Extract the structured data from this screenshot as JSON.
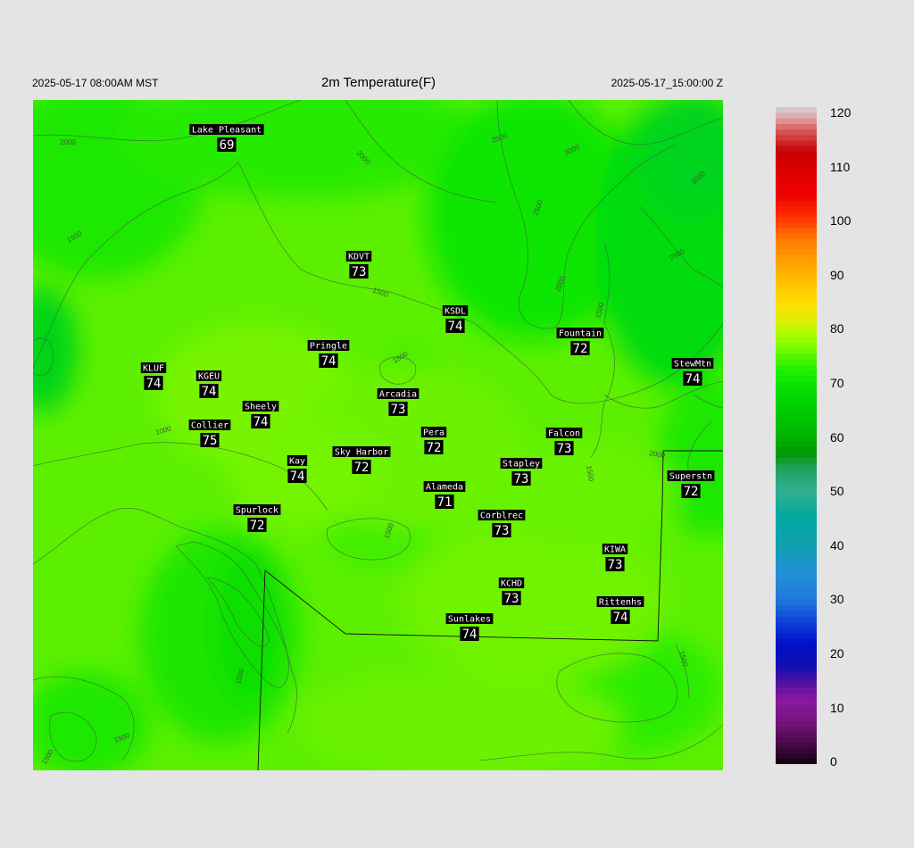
{
  "header": {
    "local_time": "2025-05-17 08:00AM MST",
    "title": "2m Temperature(F)",
    "utc_time": "2025-05-17_15:00:00 Z"
  },
  "colorbar": {
    "ticks": [
      "120",
      "110",
      "100",
      "90",
      "80",
      "70",
      "60",
      "50",
      "40",
      "30",
      "20",
      "10",
      "0"
    ],
    "min": 0,
    "max": 120
  },
  "stations": [
    {
      "name": "Lake Pleasant",
      "value": "69"
    },
    {
      "name": "KDVT",
      "value": "73"
    },
    {
      "name": "KSDL",
      "value": "74"
    },
    {
      "name": "Fountain",
      "value": "72"
    },
    {
      "name": "Pringle",
      "value": "74"
    },
    {
      "name": "StewMtn",
      "value": "74"
    },
    {
      "name": "KLUF",
      "value": "74"
    },
    {
      "name": "KGEU",
      "value": "74"
    },
    {
      "name": "Arcadia",
      "value": "73"
    },
    {
      "name": "Sheely",
      "value": "74"
    },
    {
      "name": "Collier",
      "value": "75"
    },
    {
      "name": "Pera",
      "value": "72"
    },
    {
      "name": "Falcon",
      "value": "73"
    },
    {
      "name": "Kay",
      "value": "74"
    },
    {
      "name": "Sky Harbor",
      "value": "72"
    },
    {
      "name": "Stapley",
      "value": "73"
    },
    {
      "name": "Superstn",
      "value": "72"
    },
    {
      "name": "Alameda",
      "value": "71"
    },
    {
      "name": "Spurlock",
      "value": "72"
    },
    {
      "name": "Corblrec",
      "value": "73"
    },
    {
      "name": "KIWA",
      "value": "73"
    },
    {
      "name": "KCHD",
      "value": "73"
    },
    {
      "name": "Rittenhs",
      "value": "74"
    },
    {
      "name": "Sunlakes",
      "value": "74"
    }
  ],
  "contour_labels": [
    "2000",
    "1500",
    "2000",
    "2500",
    "3000",
    "3500",
    "2500",
    "2500",
    "2000",
    "1500",
    "1500",
    "1500",
    "1000",
    "2000",
    "1500",
    "1500",
    "1500",
    "1500",
    "1500",
    "1500"
  ],
  "colors": {
    "background": "#e4e4e4",
    "map_base": "#5cf000"
  }
}
